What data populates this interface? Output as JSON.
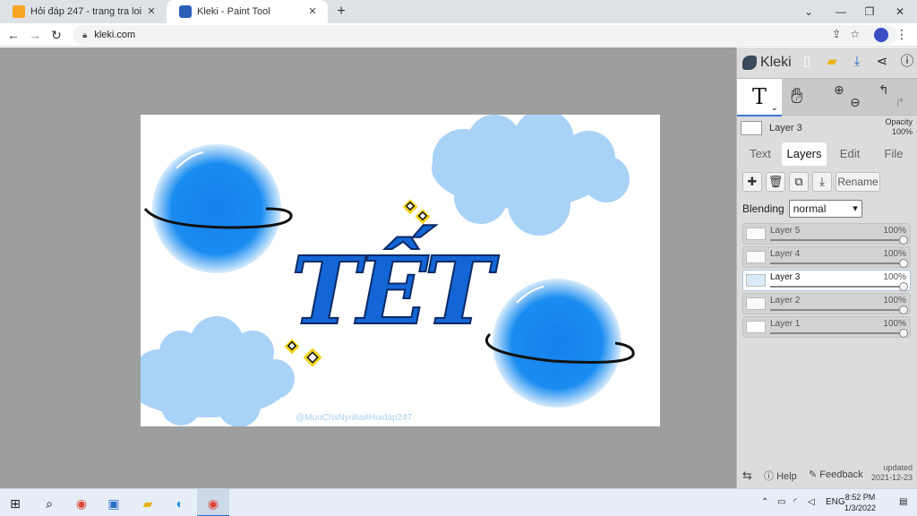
{
  "browser": {
    "tabs": [
      {
        "title": "Hỏi đáp 247 - trang tra loi",
        "active": false
      },
      {
        "title": "Kleki - Paint Tool",
        "active": true
      }
    ],
    "url": "kleki.com"
  },
  "app": {
    "brand": "Kleki",
    "current_layer": {
      "name": "Layer 3",
      "opacity_label": "Opacity",
      "opacity": "100%"
    },
    "panel_tabs": [
      "Text",
      "Layers",
      "Edit",
      "File"
    ],
    "active_panel_tab": "Layers",
    "tool_text_glyph": "T",
    "layer_buttons": {
      "rename": "Rename"
    },
    "blending": {
      "label": "Blending",
      "value": "normal"
    },
    "layers": [
      {
        "name": "Layer 5",
        "opacity": "100%",
        "selected": false
      },
      {
        "name": "Layer 4",
        "opacity": "100%",
        "selected": false
      },
      {
        "name": "Layer 3",
        "opacity": "100%",
        "selected": true
      },
      {
        "name": "Layer 2",
        "opacity": "100%",
        "selected": false
      },
      {
        "name": "Layer 1",
        "opacity": "100%",
        "selected": false
      }
    ],
    "footer": {
      "help": "Help",
      "feedback": "Feedback",
      "updated_label": "updated",
      "updated_date": "2021-12-23"
    }
  },
  "canvas": {
    "title_text": "TẾT",
    "watermark": "@MunChxNynha#Hoidap247"
  },
  "taskbar": {
    "lang": "ENG",
    "time": "8:52 PM",
    "date": "1/3/2022"
  },
  "colors": {
    "planet": "#1a8cf0",
    "cloud": "#a9d2f7",
    "title": "#1466d6",
    "sparkle": "#f2d31a",
    "accent": "#3a78d6"
  }
}
